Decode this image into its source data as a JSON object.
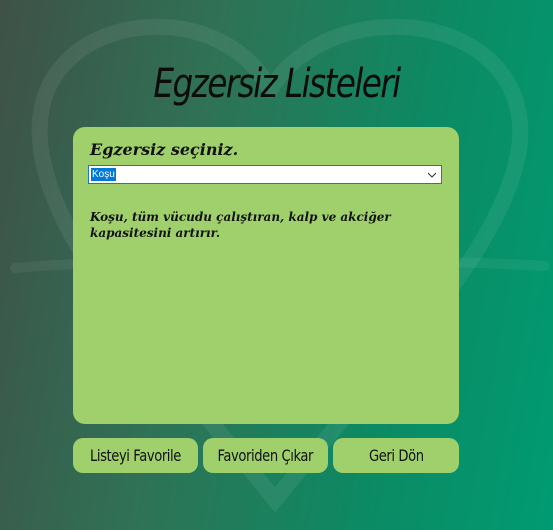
{
  "window": {
    "title": "Egzersiz Listeleri"
  },
  "panel": {
    "prompt": "Egzersiz seçiniz.",
    "dropdown": {
      "selected": "Koşu"
    },
    "description": "Koşu, tüm vücudu çalıştıran, kalp ve akciğer kapasitesini artırır."
  },
  "buttons": {
    "favorite": "Listeyi Favorile",
    "unfavorite": "Favoriden Çıkar",
    "back": "Geri Dön"
  },
  "colors": {
    "panel": "#a0d06c",
    "background_left": "#3f5148",
    "background_right": "#009b72",
    "selection": "#0078d7"
  },
  "icons": {
    "dropdown": "chevron-down-icon",
    "background": "heart-icon"
  }
}
